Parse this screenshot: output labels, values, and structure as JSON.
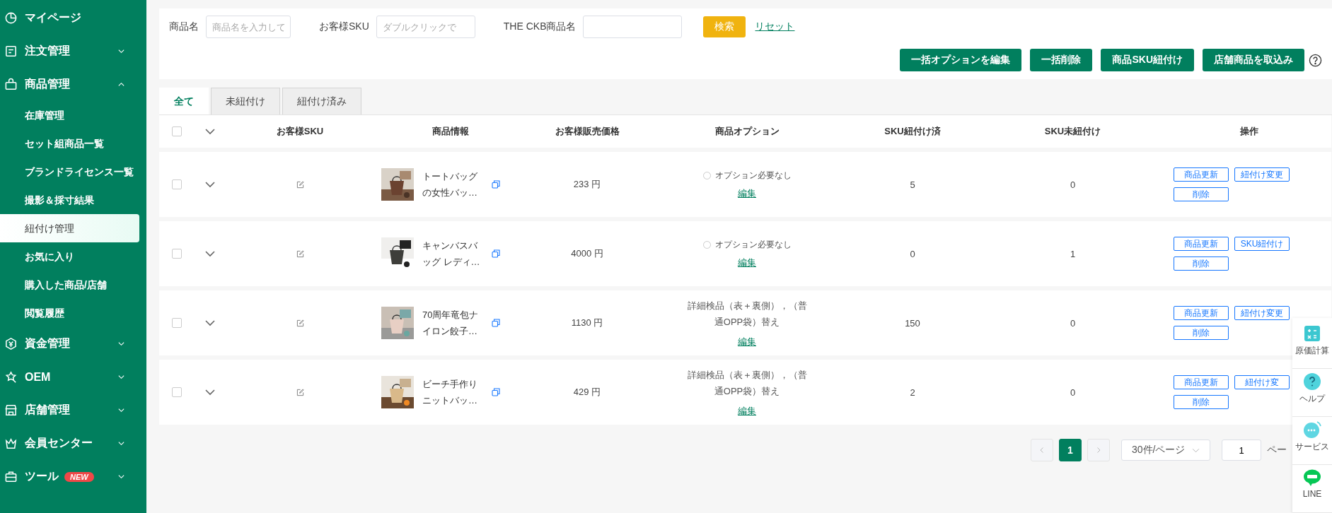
{
  "sidebar": {
    "items": [
      {
        "label": "マイページ"
      },
      {
        "label": "注文管理",
        "expanded": false
      },
      {
        "label": "商品管理",
        "expanded": true,
        "children": [
          {
            "label": "在庫管理",
            "selected": false
          },
          {
            "label": "セット組商品一覧",
            "selected": false
          },
          {
            "label": "ブランドライセンス一覧",
            "selected": false
          },
          {
            "label": "撮影＆採寸結果",
            "selected": false
          },
          {
            "label": "紐付け管理",
            "selected": true
          },
          {
            "label": "お気に入り",
            "selected": false
          },
          {
            "label": "購入した商品/店舗",
            "selected": false
          },
          {
            "label": "閲覧履歴",
            "selected": false
          }
        ]
      },
      {
        "label": "資金管理",
        "expanded": false
      },
      {
        "label": "OEM",
        "expanded": false
      },
      {
        "label": "店舗管理",
        "expanded": false
      },
      {
        "label": "会員センター",
        "expanded": false
      },
      {
        "label": "ツール",
        "badge": "NEW",
        "expanded": false
      }
    ]
  },
  "filters": {
    "fields": [
      {
        "label": "商品名",
        "placeholder": "商品名を入力して"
      },
      {
        "label": "お客様SKU",
        "placeholder": "ダブルクリックで"
      },
      {
        "label": "THE CKB商品名"
      }
    ],
    "search_button": "検索",
    "reset_link": "リセット"
  },
  "actions": [
    "一括オプションを編集",
    "一括削除",
    "商品SKU紐付け",
    "店舗商品を取込み"
  ],
  "tabs": [
    {
      "label": "全て",
      "selected": true
    },
    {
      "label": "未紐付け",
      "selected": false
    },
    {
      "label": "紐付け済み",
      "selected": false
    }
  ],
  "table": {
    "select_all": {
      "checked": false
    },
    "columns": [
      "お客様SKU",
      "商品情報",
      "お客様販売価格",
      "商品オプション",
      "SKU紐付け済",
      "SKU未紐付け",
      "操作"
    ],
    "rows": [
      {
        "checked": false,
        "product_name": "トートバッグの女性バッ…",
        "price": "233 円",
        "option": {
          "kind": "none",
          "selected": false,
          "text": "オプション必要なし"
        },
        "option_link": "編集",
        "linked": "5",
        "unlinked": "0",
        "operations": [
          "商品更新",
          "紐付け変更",
          "削除"
        ]
      },
      {
        "checked": false,
        "product_name": "キャンバスバッグ レディ…",
        "price": "4000 円",
        "option": {
          "kind": "none",
          "selected": false,
          "text": "オプション必要なし"
        },
        "option_link": "編集",
        "linked": "0",
        "unlinked": "1",
        "operations": [
          "商品更新",
          "SKU紐付け",
          "削除"
        ]
      },
      {
        "checked": false,
        "product_name": "70周年竜包ナイロン餃子…",
        "price": "1130 円",
        "option": {
          "kind": "text",
          "text": "詳細検品（表＋裏側），（普通OPP袋）替え"
        },
        "option_link": "編集",
        "linked": "150",
        "unlinked": "0",
        "operations": [
          "商品更新",
          "紐付け変更",
          "削除"
        ]
      },
      {
        "checked": false,
        "product_name": "ビーチ手作りニットバッ…",
        "price": "429 円",
        "option": {
          "kind": "text",
          "text": "詳細検品（表＋裏側），（普通OPP袋）替え"
        },
        "option_link": "編集",
        "linked": "2",
        "unlinked": "0",
        "operations": [
          "商品更新",
          "紐付け変",
          "削除"
        ]
      }
    ]
  },
  "pagination": {
    "pages": [
      {
        "label": "1",
        "selected": true
      }
    ],
    "page_size": "30件/ページ",
    "jump_value": "1",
    "jump_suffix": "ペー"
  },
  "float_panel": {
    "items": [
      {
        "label": "原価計算"
      },
      {
        "label": "ヘルプ"
      },
      {
        "label": "サービス"
      },
      {
        "label": "LINE"
      }
    ]
  }
}
